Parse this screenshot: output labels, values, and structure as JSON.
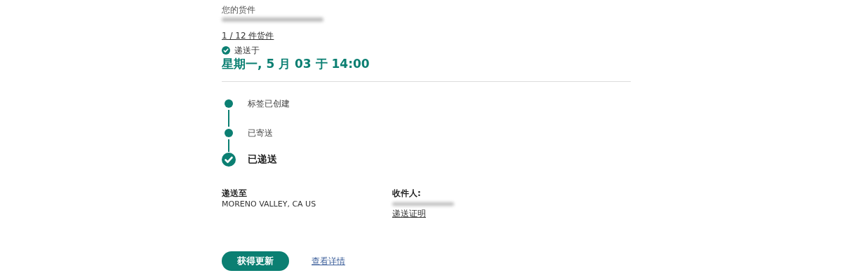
{
  "shipment": {
    "heading": "您的货件",
    "count_link": "1 / 12 件货件",
    "status_label": "递送于",
    "delivered_at": "星期一, 5 月 03 于 14:00"
  },
  "steps": [
    {
      "label": "标签已创建",
      "current": false
    },
    {
      "label": "已寄送",
      "current": false
    },
    {
      "label": "已递送",
      "current": true
    }
  ],
  "delivered_to": {
    "label": "递送至",
    "value": "MORENO VALLEY, CA US"
  },
  "recipient": {
    "label": "收件人:",
    "proof_link": "递送证明"
  },
  "actions": {
    "primary": "获得更新",
    "secondary": "查看详情"
  }
}
